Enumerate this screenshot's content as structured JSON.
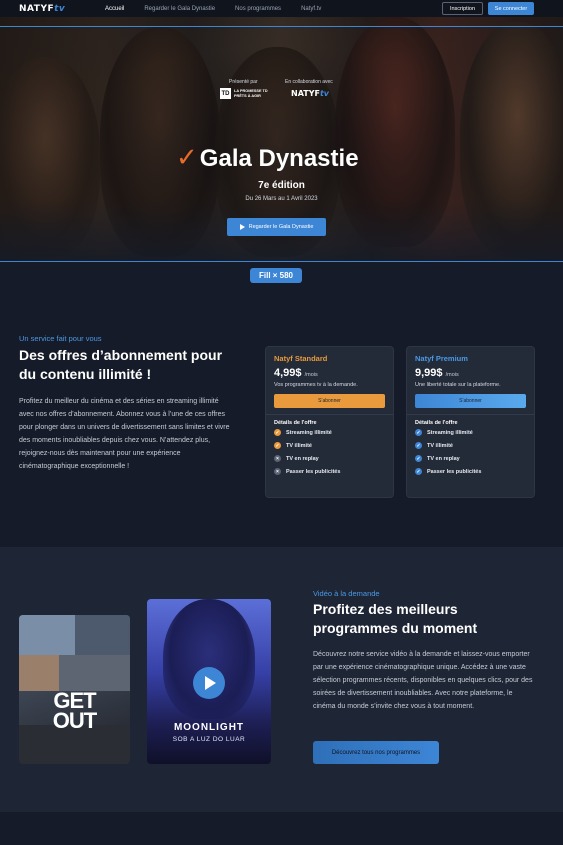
{
  "nav": {
    "logo_main": "NATYF",
    "logo_tv": "tv",
    "links": [
      "Accueil",
      "Regarder le Gala Dynastie",
      "Nos programmes",
      "Natyf.tv"
    ],
    "active_index": 0,
    "signup": "Inscription",
    "login": "Se connecter"
  },
  "hero": {
    "presented_by": "Présenté par",
    "in_collab": "En collaboration avec",
    "td_logo": "TD",
    "td_text": "LA PROMESSE TD PRÊTS À AGIR",
    "partner_logo_main": "NATYF",
    "partner_logo_tv": "tv",
    "title": "Gala Dynastie",
    "edition": "7e édition",
    "dates": "Du 26 Mars au 1 Avril 2023",
    "watch_button": "Regarder le Gala Dynastie",
    "fill_badge": "Fill × 580"
  },
  "offers": {
    "eyebrow": "Un service fait pour vous",
    "title": "Des offres d’abonnement pour du contenu illimité !",
    "description": "Profitez du meilleur du cinéma et des séries en streaming illimité avec nos offres d’abonnement. Abonnez vous à l’une de ces offres pour plonger dans un univers de divertissement sans limites et vivre des moments inoubliables depuis chez vous. N’attendez plus, rejoignez-nous dès maintenant pour une expérience cinématographique exceptionnelle !",
    "plans": [
      {
        "name": "Natyf Standard",
        "price": "4,99$",
        "period": "/mois",
        "tagline": "Vos programmes tv à la demande.",
        "button": "S'abonner",
        "details_label": "Détails de l'offre",
        "features": [
          {
            "label": "Streaming illimité",
            "included": true
          },
          {
            "label": "TV illimité",
            "included": true
          },
          {
            "label": "TV en replay",
            "included": false
          },
          {
            "label": "Passer les publicités",
            "included": false
          }
        ]
      },
      {
        "name": "Natyf Premium",
        "price": "9,99$",
        "period": "/mois",
        "tagline": "Une liberté totale sur la plateforme.",
        "button": "S'abonner",
        "details_label": "Détails de l'offre",
        "features": [
          {
            "label": "Streaming illimité",
            "included": true
          },
          {
            "label": "TV illimité",
            "included": true
          },
          {
            "label": "TV en replay",
            "included": true
          },
          {
            "label": "Passer les publicités",
            "included": true
          }
        ]
      }
    ]
  },
  "vod": {
    "eyebrow": "Vidéo à la demande",
    "title": "Profitez des meilleurs programmes du moment",
    "description": "Découvrez notre service vidéo à la demande et laissez-vous emporter par une expérience cinématographique unique. Accédez à une vaste sélection programmes récents, disponibles en quelques clics, pour des soirées de divertissement inoubliables. Avec notre plateforme, le cinéma du monde s’invite chez vous à tout moment.",
    "button": "Découvrez tous nos programmes",
    "posters": [
      {
        "title_line1": "GET",
        "title_line2": "OUT"
      },
      {
        "title": "MOONLIGHT",
        "subtitle": "SOB A LUZ DO LUAR"
      }
    ]
  },
  "colors": {
    "accent_blue": "#3d86d6",
    "accent_orange": "#e89a3c",
    "background": "#151b28"
  }
}
